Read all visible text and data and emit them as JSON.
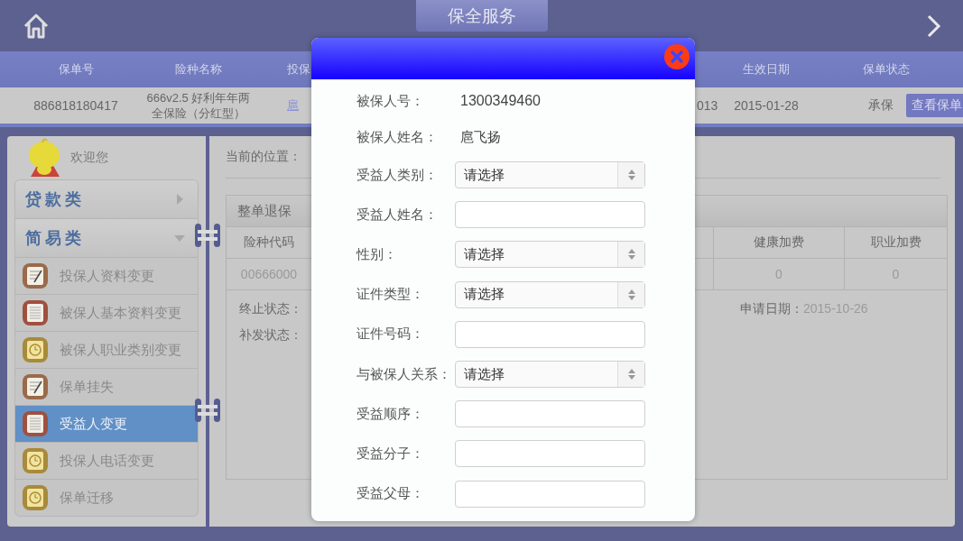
{
  "top_bar": {
    "title": "保全服务"
  },
  "policy_table": {
    "columns": [
      "保单号",
      "险种名称",
      "投保",
      "生效日期",
      "保单状态"
    ],
    "row": {
      "policy_no": "886818180417",
      "product_lines": [
        "666v2.5 好利年年两",
        "全保险（分红型）"
      ],
      "holder": "扈",
      "column_4": "013",
      "effective_date": "2015-01-28",
      "status": "承保",
      "action": "查看保单"
    }
  },
  "sidebar": {
    "welcome": "欢迎您",
    "categories": [
      {
        "label": "贷款类",
        "expanded": false
      },
      {
        "label": "简易类",
        "expanded": true,
        "items": [
          {
            "label": "投保人资料变更",
            "kind": "clipboard",
            "selected": false
          },
          {
            "label": "被保人基本资料变更",
            "kind": "newspaper",
            "selected": false
          },
          {
            "label": "被保人职业类别变更",
            "kind": "timer",
            "selected": false
          },
          {
            "label": "保单挂失",
            "kind": "clipboard",
            "selected": false
          },
          {
            "label": "受益人变更",
            "kind": "newspaper",
            "selected": true
          },
          {
            "label": "投保人电话变更",
            "kind": "timer",
            "selected": false
          },
          {
            "label": "保单迁移",
            "kind": "timer",
            "selected": false
          }
        ]
      }
    ]
  },
  "detail": {
    "breadcrumb": "当前的位置：",
    "table": {
      "title": "整单退保",
      "columns": [
        "险种代码",
        "健康加费",
        "职业加费"
      ],
      "row": [
        "00666000",
        "0",
        "0"
      ]
    },
    "status_lines": [
      "终止状态：",
      "补发状态："
    ],
    "apply_date": {
      "label": "申请日期：",
      "value": "2015-10-26"
    }
  },
  "dialog": {
    "fields": [
      {
        "kind": "text",
        "label": "被保人号：",
        "value": "1300349460"
      },
      {
        "kind": "text",
        "label": "被保人姓名：",
        "value": "扈飞扬"
      },
      {
        "kind": "select",
        "label": "受益人类别：",
        "value": "请选择"
      },
      {
        "kind": "input",
        "label": "受益人姓名："
      },
      {
        "kind": "select",
        "label": "性别：",
        "value": "请选择"
      },
      {
        "kind": "select",
        "label": "证件类型：",
        "value": "请选择"
      },
      {
        "kind": "input",
        "label": "证件号码："
      },
      {
        "kind": "select",
        "label": "与被保人关系：",
        "value": "请选择"
      },
      {
        "kind": "input",
        "label": "受益顺序："
      },
      {
        "kind": "input",
        "label": "受益分子："
      },
      {
        "kind": "input",
        "label": "受益父母："
      }
    ]
  }
}
